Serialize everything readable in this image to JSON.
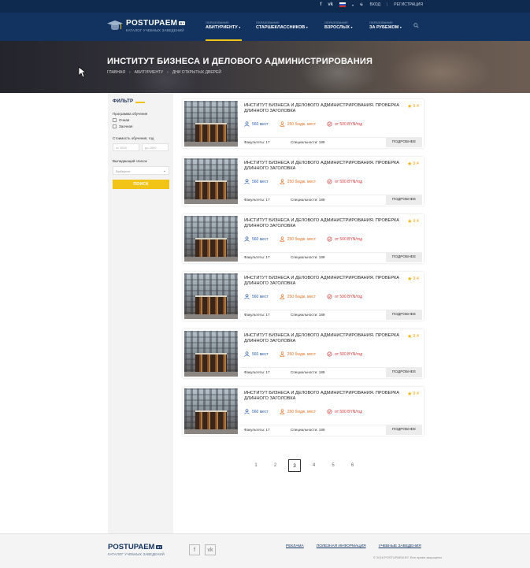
{
  "topbar": {
    "social": [
      "f",
      "vk"
    ],
    "login": "ВХОД",
    "register": "РЕГИСТРАЦИЯ",
    "separator": "|"
  },
  "logo": {
    "name": "POSTUPAEM",
    "tld": "BY",
    "subtitle": "КАТАЛОГ УЧЕБНЫХ ЗАВЕДЕНИЙ"
  },
  "nav": [
    {
      "top": "ОБРАЗОВАНИЕ",
      "main": "АБИТУРИЕНТУ",
      "active": true
    },
    {
      "top": "ОБРАЗОВАНИЕ",
      "main": "СТАРШЕКЛАССНИКОВ",
      "active": false
    },
    {
      "top": "ОБРАЗОВАНИЕ",
      "main": "ВЗРОСЛЫХ",
      "active": false
    },
    {
      "top": "ОБРАЗОВАНИЕ",
      "main": "ЗА РУБЕЖОМ",
      "active": false
    }
  ],
  "hero": {
    "title": "ИНСТИТУТ БИЗНЕСА И ДЕЛОВОГО АДМИНИСТРИРОВАНИЯ",
    "breadcrumb": [
      "ГЛАВНАЯ",
      "АБИТУРИЕНТУ",
      "ДНИ ОТКРЫТЫХ ДВЕРЕЙ"
    ]
  },
  "filter": {
    "title": "ФИЛЬТР",
    "program_label": "Программа обучения",
    "options": [
      "Очная",
      "Заочная"
    ],
    "cost_label": "Стоимость обучения, год",
    "cost_from": "от 2500",
    "cost_to": "до 2500",
    "city_label": "Выпадающий список",
    "city_value": "Выберите",
    "search_button": "ПОИСК"
  },
  "cards": [
    {
      "name": "ИНСТИТУТ БИЗНЕСА И ДЕЛОВОГО АДМИНИСТРИРОВАНИЯ. ПРОВЕРКА ДЛИННОГО ЗАГОЛОВКА",
      "rating": "9.4",
      "places": "560 мест",
      "budget": "250 бюдж. мест",
      "price": "от 500 BYN/год",
      "faculties": "Факультеты: 17",
      "specialties": "Специальности: 189",
      "more": "ПОДРОБНЕЕ"
    },
    {
      "name": "ИНСТИТУТ БИЗНЕСА И ДЕЛОВОГО АДМИНИСТРИРОВАНИЯ. ПРОВЕРКА ДЛИННОГО ЗАГОЛОВКА",
      "rating": "9.4",
      "places": "560 мест",
      "budget": "250 бюдж. мест",
      "price": "от 500 BYN/год",
      "faculties": "Факультеты: 17",
      "specialties": "Специальности: 189",
      "more": "ПОДРОБНЕЕ"
    },
    {
      "name": "ИНСТИТУТ БИЗНЕСА И ДЕЛОВОГО АДМИНИСТРИРОВАНИЯ. ПРОВЕРКА ДЛИННОГО ЗАГОЛОВКА",
      "rating": "9.4",
      "places": "560 мест",
      "budget": "250 бюдж. мест",
      "price": "от 500 BYN/год",
      "faculties": "Факультеты: 17",
      "specialties": "Специальности: 189",
      "more": "ПОДРОБНЕЕ"
    },
    {
      "name": "ИНСТИТУТ БИЗНЕСА И ДЕЛОВОГО АДМИНИСТРИРОВАНИЯ. ПРОВЕРКА ДЛИННОГО ЗАГОЛОВКА",
      "rating": "9.4",
      "places": "560 мест",
      "budget": "250 бюдж. мест",
      "price": "от 500 BYN/год",
      "faculties": "Факультеты: 17",
      "specialties": "Специальности: 189",
      "more": "ПОДРОБНЕЕ"
    },
    {
      "name": "ИНСТИТУТ БИЗНЕСА И ДЕЛОВОГО АДМИНИСТРИРОВАНИЯ. ПРОВЕРКА ДЛИННОГО ЗАГОЛОВКА",
      "rating": "9.4",
      "places": "560 мест",
      "budget": "250 бюдж. мест",
      "price": "от 500 BYN/год",
      "faculties": "Факультеты: 17",
      "specialties": "Специальности: 189",
      "more": "ПОДРОБНЕЕ"
    },
    {
      "name": "ИНСТИТУТ БИЗНЕСА И ДЕЛОВОГО АДМИНИСТРИРОВАНИЯ. ПРОВЕРКА ДЛИННОГО ЗАГОЛОВКА",
      "rating": "9.4",
      "places": "560 мест",
      "budget": "250 бюдж. мест",
      "price": "от 500 BYN/год",
      "faculties": "Факультеты: 17",
      "specialties": "Специальности: 189",
      "more": "ПОДРОБНЕЕ"
    }
  ],
  "pagination": {
    "pages": [
      "1",
      "2",
      "3",
      "4",
      "5",
      "6"
    ],
    "current": "3"
  },
  "footer": {
    "logo_name": "POSTUPAEM",
    "logo_tld": "BY",
    "logo_subtitle": "КАТАЛОГ УЧЕБНЫХ ЗАВЕДЕНИЙ",
    "social": [
      "f",
      "vk"
    ],
    "links": [
      "РЕКЛАМА",
      "ПОЛЕЗНАЯ ИНФОРМАЦИЯ",
      "УЧЕБНЫЕ ЗАВЕДЕНИЯ"
    ],
    "copyright": "© 2018 POSTUPAEM.BY. Все права защищены"
  },
  "colors": {
    "header": "#12335f",
    "topbar": "#0f2a4f",
    "accent": "#f2c417",
    "places": "#2f5faf",
    "budget": "#e2742a",
    "price": "#d23b3b"
  },
  "icons": {
    "places": "user-icon",
    "budget": "hand-coin-icon",
    "price": "price-tag-icon",
    "rating": "star-icon",
    "search": "search-icon"
  }
}
